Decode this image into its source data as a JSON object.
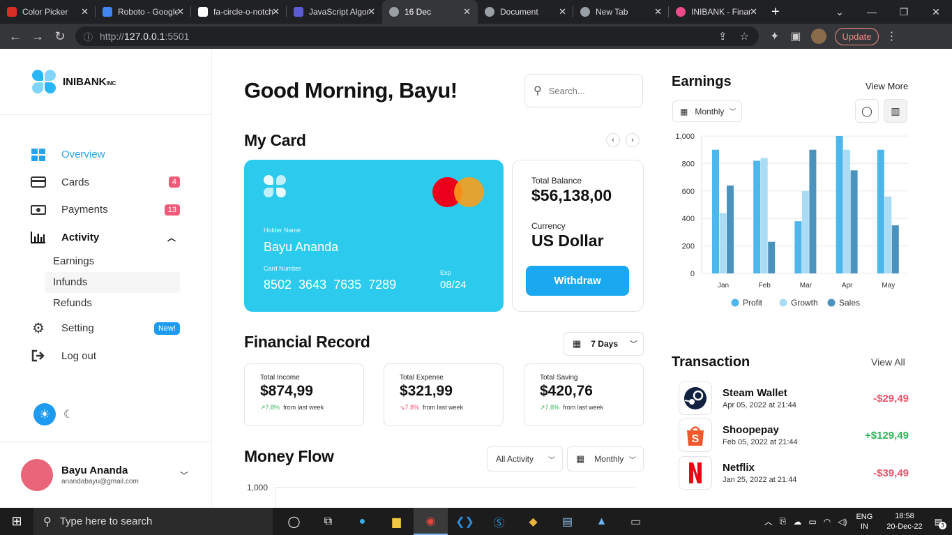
{
  "browser": {
    "tabs": [
      {
        "title": "Color Picker",
        "fav": "#d93025"
      },
      {
        "title": "Roboto - Google Fonts",
        "fav": "#4285f4"
      },
      {
        "title": "fa-circle-o-notch",
        "fav": "#ffffff"
      },
      {
        "title": "JavaScript Algorithms",
        "fav": "#5b5bd6"
      },
      {
        "title": "16 Dec",
        "fav": "#9aa0a6"
      },
      {
        "title": "Document",
        "fav": "#9aa0a6"
      },
      {
        "title": "New Tab",
        "fav": "#9aa0a6"
      },
      {
        "title": "INIBANK - Finance",
        "fav": "#ea4c89"
      }
    ],
    "url_prefix": "http://",
    "url_host": "127.0.0.1",
    "url_port": ":5501",
    "update_label": "Update"
  },
  "sidebar": {
    "logo_text": "INIBANK",
    "logo_suffix": "INC",
    "items": [
      {
        "label": "Overview"
      },
      {
        "label": "Cards",
        "badge": "4"
      },
      {
        "label": "Payments",
        "badge": "13"
      },
      {
        "label": "Activity"
      }
    ],
    "subitems": [
      "Earnings",
      "Infunds",
      "Refunds"
    ],
    "setting_label": "Setting",
    "setting_badge": "New!",
    "logout_label": "Log out",
    "profile": {
      "name": "Bayu Ananda",
      "email": "anandabayu@gmail.com"
    }
  },
  "main": {
    "greeting": "Good Morning, Bayu!",
    "search_placeholder": "Search...",
    "my_card_title": "My Card",
    "card": {
      "holder_label": "Holder Name",
      "holder": "Bayu Ananda",
      "number_label": "Card Number",
      "number": "8502  3643  7635  7289",
      "exp_label": "Exp",
      "exp": "08/24"
    },
    "balance": {
      "total_label": "Total Balance",
      "total": "$56,138,00",
      "currency_label": "Currency",
      "currency": "US Dollar",
      "withdraw": "Withdraw"
    },
    "financial_title": "Financial Record",
    "period": "7 Days",
    "stats": [
      {
        "label": "Total Income",
        "value": "$874,99",
        "change": "7.8%",
        "dir": "up",
        "suffix": "from last week"
      },
      {
        "label": "Total Expense",
        "value": "$321,99",
        "change": "7.8%",
        "dir": "down",
        "suffix": "from last week"
      },
      {
        "label": "Total Saving",
        "value": "$420,76",
        "change": "7.8%",
        "dir": "up",
        "suffix": "from last week"
      }
    ],
    "money_flow_title": "Money Flow",
    "activity_filter": "All Activity",
    "flow_period": "Monthly",
    "flow_y_top": "1,000"
  },
  "earnings": {
    "title": "Earnings",
    "view_more": "View More",
    "period": "Monthly"
  },
  "chart_data": {
    "type": "bar",
    "categories": [
      "Jan",
      "Feb",
      "Mar",
      "Apr",
      "May"
    ],
    "series": [
      {
        "name": "Profit",
        "color": "#4db6ec",
        "values": [
          900,
          820,
          380,
          1000,
          900
        ]
      },
      {
        "name": "Growth",
        "color": "#aadcf6",
        "values": [
          440,
          840,
          600,
          900,
          560
        ]
      },
      {
        "name": "Sales",
        "color": "#4b93bd",
        "values": [
          640,
          230,
          900,
          750,
          350
        ]
      }
    ],
    "yticks": [
      "0",
      "200",
      "400",
      "600",
      "800",
      "1,000"
    ],
    "ylim": [
      0,
      1000
    ],
    "legend": "bottom"
  },
  "transactions": {
    "title": "Transaction",
    "view_all": "View All",
    "items": [
      {
        "name": "Steam Wallet",
        "date": "Apr 05, 2022 at 21:44",
        "amount": "-$29,49",
        "sign": "neg"
      },
      {
        "name": "Shoopepay",
        "date": "Feb 05, 2022 at 21:44",
        "amount": "+$129,49",
        "sign": "pos"
      },
      {
        "name": "Netflix",
        "date": "Jan 25, 2022 at 21:44",
        "amount": "-$39,49",
        "sign": "neg"
      }
    ]
  },
  "taskbar": {
    "search_placeholder": "Type here to search",
    "lang1": "ENG",
    "lang2": "IN",
    "time": "18:58",
    "date": "20-Dec-22",
    "notif": "3"
  }
}
